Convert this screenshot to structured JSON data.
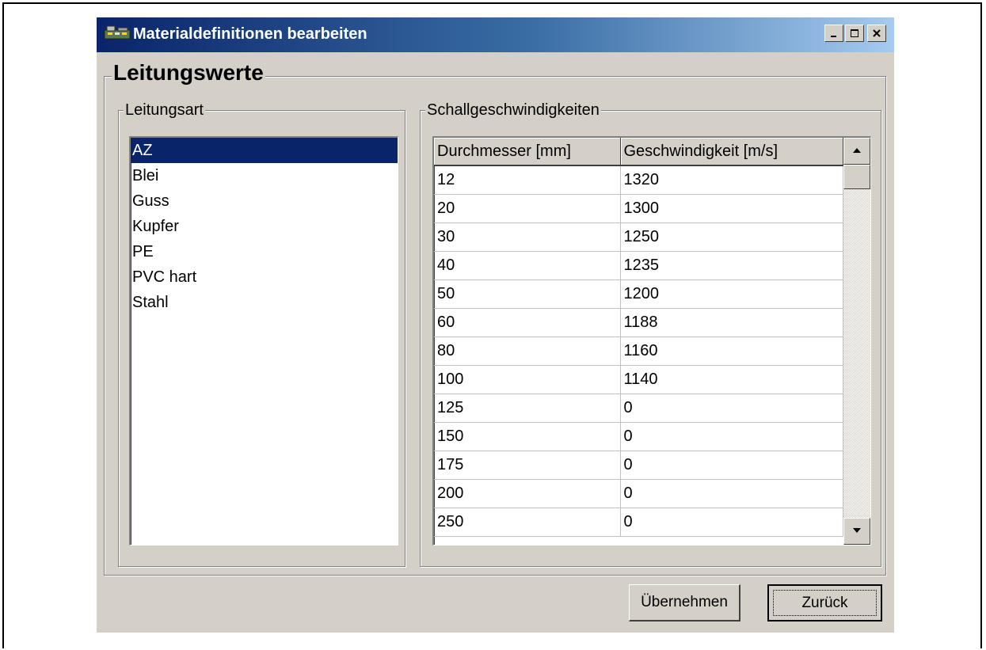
{
  "window": {
    "title": "Materialdefinitionen bearbeiten",
    "controls": {
      "minimize": "_",
      "maximize": "□",
      "close": "×"
    }
  },
  "main_group": {
    "title": "Leitungswerte"
  },
  "pipe_type_group": {
    "title": "Leitungsart",
    "items": [
      "AZ",
      "Blei",
      "Guss",
      "Kupfer",
      "PE",
      "PVC hart",
      "Stahl"
    ],
    "selected": "AZ"
  },
  "speed_group": {
    "title": "Schallgeschwindigkeiten",
    "columns": [
      "Durchmesser [mm]",
      "Geschwindigkeit [m/s]"
    ],
    "rows": [
      [
        "12",
        "1320"
      ],
      [
        "20",
        "1300"
      ],
      [
        "30",
        "1250"
      ],
      [
        "40",
        "1235"
      ],
      [
        "50",
        "1200"
      ],
      [
        "60",
        "1188"
      ],
      [
        "80",
        "1160"
      ],
      [
        "100",
        "1140"
      ],
      [
        "125",
        "0"
      ],
      [
        "150",
        "0"
      ],
      [
        "175",
        "0"
      ],
      [
        "200",
        "0"
      ],
      [
        "250",
        "0"
      ]
    ]
  },
  "buttons": {
    "apply": "Übernehmen",
    "back": "Zurück"
  },
  "icons": {
    "app": "toolbox-icon",
    "minimize": "minimize-icon",
    "maximize": "maximize-icon",
    "close": "close-icon",
    "scroll_up": "arrow-up-icon",
    "scroll_down": "arrow-down-icon"
  },
  "colors": {
    "title_start": "#0a246a",
    "title_end": "#a6caf0",
    "selection": "#0a246a",
    "face": "#d4d0c8"
  }
}
